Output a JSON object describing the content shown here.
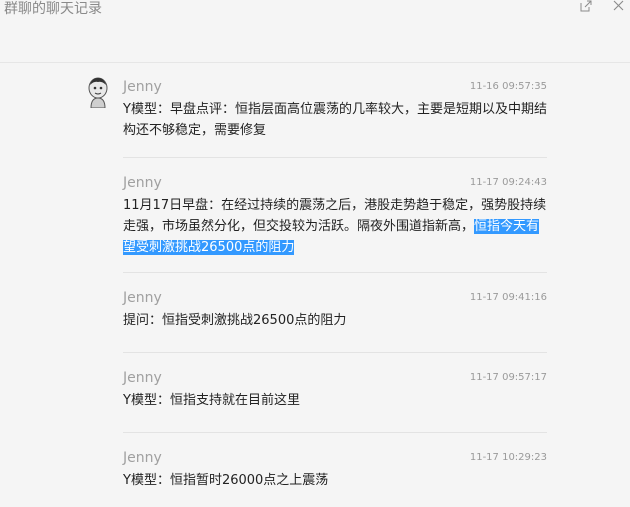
{
  "window": {
    "title": "群聊的聊天记录",
    "open_icon": "open-external-icon",
    "close_icon": "close-icon"
  },
  "messages": [
    {
      "sender": "Jenny",
      "time": "11-16 09:57:35",
      "text": "Y模型：早盘点评：恒指层面高位震荡的几率较大，主要是短期以及中期结构还不够稳定，需要修复"
    },
    {
      "sender": "Jenny",
      "time": "11-17 09:24:43",
      "text": "11月17日早盘：在经过持续的震荡之后，港股走势趋于稳定，强势股持续走强，市场虽然分化，但交投较为活跃。隔夜外围道指新高，",
      "highlighted_text": "恒指今天有望受刺激挑战26500点的阻力"
    },
    {
      "sender": "Jenny",
      "time": "11-17 09:41:16",
      "text": "提问：恒指受刺激挑战26500点的阻力"
    },
    {
      "sender": "Jenny",
      "time": "11-17 09:57:17",
      "text": "Y模型：恒指支持就在目前这里"
    },
    {
      "sender": "Jenny",
      "time": "11-17 10:29:23",
      "text": "Y模型：恒指暂时26000点之上震荡"
    }
  ],
  "colors": {
    "background": "#f5f5f5",
    "highlight": "#3399ff"
  }
}
